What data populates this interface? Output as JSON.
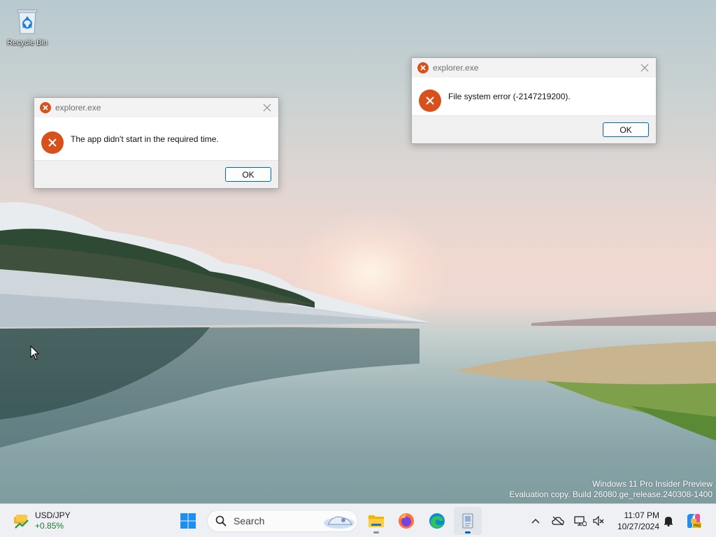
{
  "desktop": {
    "icons": [
      {
        "label": "Recycle Bin",
        "icon": "recycle-bin-icon"
      }
    ],
    "watermark": {
      "line1": "Windows 11 Pro Insider Preview",
      "line2": "Evaluation copy. Build 26080.ge_release.240308-1400"
    }
  },
  "dialogs": [
    {
      "title": "explorer.exe",
      "message": "The app didn't start in the required time.",
      "ok_label": "OK",
      "icon": "error-icon"
    },
    {
      "title": "explorer.exe",
      "message": "File system error (-2147219200).",
      "ok_label": "OK",
      "icon": "error-icon"
    }
  ],
  "taskbar": {
    "widget": {
      "pair": "USD/JPY",
      "change": "+0.85%",
      "change_color": "#1b7a2f"
    },
    "search": {
      "placeholder": "Search"
    },
    "apps": [
      {
        "name": "start",
        "icon": "windows-start-icon"
      },
      {
        "name": "file-explorer",
        "icon": "folder-icon"
      },
      {
        "name": "firefox",
        "icon": "firefox-icon"
      },
      {
        "name": "edge",
        "icon": "edge-icon"
      },
      {
        "name": "app",
        "icon": "installer-icon",
        "active": true
      }
    ],
    "tray": {
      "icons": [
        "chevron-up-icon",
        "onedrive-offline-icon",
        "network-icon",
        "volume-muted-icon"
      ],
      "time": "11:07 PM",
      "date": "10/27/2024",
      "notification_icon": "bell-icon",
      "copilot_icon": "copilot-icon"
    }
  },
  "colors": {
    "error_accent": "#d8511c",
    "button_border": "#0067c0",
    "taskbar_bg": "#eef0f3"
  }
}
